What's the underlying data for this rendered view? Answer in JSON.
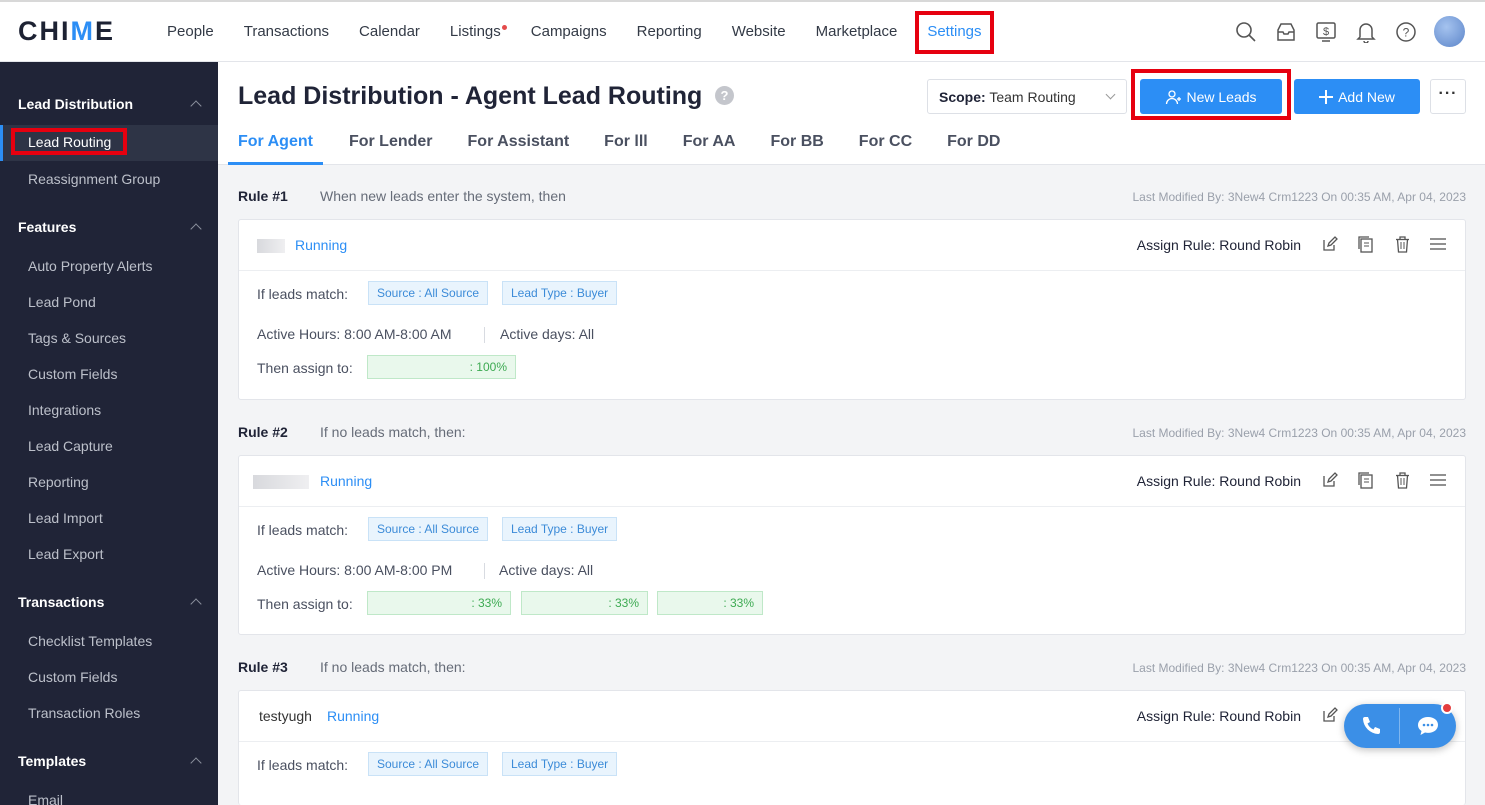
{
  "logo": {
    "pre": "CHI",
    "mid": "M",
    "post": "E"
  },
  "nav": {
    "items": [
      "People",
      "Transactions",
      "Calendar",
      "Listings",
      "Campaigns",
      "Reporting",
      "Website",
      "Marketplace",
      "Settings"
    ]
  },
  "sidebar": {
    "lead_distribution": "Lead Distribution",
    "lead_routing": "Lead Routing",
    "reassignment_group": "Reassignment Group",
    "features": "Features",
    "feature_items": [
      "Auto Property Alerts",
      "Lead Pond",
      "Tags & Sources",
      "Custom Fields",
      "Integrations",
      "Lead Capture",
      "Reporting",
      "Lead Import",
      "Lead Export"
    ],
    "transactions": "Transactions",
    "transaction_items": [
      "Checklist Templates",
      "Custom Fields",
      "Transaction Roles"
    ],
    "templates": "Templates",
    "template_items": [
      "Email"
    ]
  },
  "header": {
    "title": "Lead Distribution - Agent Lead Routing",
    "scope_label": "Scope:",
    "scope_value": "Team Routing",
    "new_leads": "New Leads",
    "add_new": "Add New",
    "more": "···"
  },
  "tabs": [
    "For Agent",
    "For Lender",
    "For Assistant",
    "For lll",
    "For AA",
    "For BB",
    "For CC",
    "For DD"
  ],
  "rules": [
    {
      "num": "Rule #1",
      "desc": "When new leads enter the system, then",
      "meta": "Last Modified By: 3New4 Crm1223  On 00:35 AM, Apr 04, 2023",
      "name": "",
      "status": "Running",
      "assign_rule": "Assign Rule: Round Robin",
      "match_label": "If leads match:",
      "tags": [
        "Source : All Source",
        "Lead Type : Buyer"
      ],
      "hours": "Active Hours: 8:00 AM-8:00 AM",
      "days": "Active days: All",
      "assign_label": "Then assign to:",
      "assignees": [
        ": 100%"
      ]
    },
    {
      "num": "Rule #2",
      "desc": "If no leads match, then:",
      "meta": "Last Modified By: 3New4 Crm1223  On 00:35 AM, Apr 04, 2023",
      "name": "",
      "status": "Running",
      "assign_rule": "Assign Rule: Round Robin",
      "match_label": "If leads match:",
      "tags": [
        "Source : All Source",
        "Lead Type : Buyer"
      ],
      "hours": "Active Hours: 8:00 AM-8:00 PM",
      "days": "Active days: All",
      "assign_label": "Then assign to:",
      "assignees": [
        ": 33%",
        ": 33%",
        ": 33%"
      ]
    },
    {
      "num": "Rule #3",
      "desc": "If no leads match, then:",
      "meta": "Last Modified By: 3New4 Crm1223  On 00:35 AM, Apr 04, 2023",
      "name": "testyugh",
      "status": "Running",
      "assign_rule": "Assign Rule: Round Robin",
      "match_label": "If leads match:",
      "tags": [
        "Source : All Source",
        "Lead Type : Buyer"
      ]
    }
  ],
  "colors": {
    "accent": "#2c8ef5",
    "sidebar": "#202437",
    "highlight": "#e6000f",
    "running": "#2c8ef5"
  }
}
